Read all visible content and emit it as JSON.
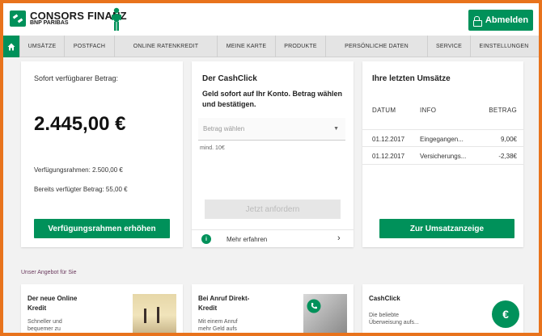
{
  "brand": {
    "name": "CONSORS FINANZ",
    "sub": "BNP PARIBAS"
  },
  "header": {
    "logout_label": "Abmelden"
  },
  "nav": {
    "items": [
      "UMSÄTZE",
      "POSTFACH",
      "ONLINE RATENKREDIT",
      "MEINE KARTE",
      "PRODUKTE",
      "PERSÖNLICHE DATEN",
      "SERVICE",
      "EINSTELLUNGEN"
    ]
  },
  "balance_card": {
    "label": "Sofort verfügbarer Betrag:",
    "amount": "2.445,00 €",
    "limit_label": "Verfügungsrahmen: 2.500,00 €",
    "used_label": "Bereits verfügter Betrag: 55,00 €",
    "button": "Verfügungsrahmen erhöhen"
  },
  "cashclick_card": {
    "title": "Der CashClick",
    "desc_line1": "Geld sofort auf Ihr Konto. Betrag wählen",
    "desc_line2": "und bestätigen.",
    "select_placeholder": "Betrag wählen",
    "min_note": "mind. 10€",
    "request_button": "Jetzt anfordern",
    "more_link": "Mehr erfahren"
  },
  "transactions_card": {
    "title": "Ihre letzten Umsätze",
    "columns": [
      "DATUM",
      "INFO",
      "BETRAG"
    ],
    "rows": [
      {
        "date": "01.12.2017",
        "info": "Eingegangen...",
        "amount": "9,00€"
      },
      {
        "date": "01.12.2017",
        "info": "Versicherungs...",
        "amount": "-2,38€"
      }
    ],
    "button": "Zur Umsatzanzeige"
  },
  "offers": {
    "section_title": "Unser Angebot für Sie",
    "cards": [
      {
        "title_line1": "Der neue Online",
        "title_line2": "Kredit",
        "sub_line1": "Schneller und",
        "sub_line2": "bequemer zu"
      },
      {
        "title_line1": "Bei Anruf Direkt-",
        "title_line2": "Kredit",
        "sub_line1": "Mit einem Anruf",
        "sub_line2": "mehr Geld aufs"
      },
      {
        "title_line1": "CashClick",
        "title_line2": "",
        "sub_line1": "Die beliebte",
        "sub_line2": "Überweisung aufs..."
      }
    ]
  },
  "colors": {
    "brand_green": "#00915a",
    "frame_orange": "#e8731c"
  }
}
